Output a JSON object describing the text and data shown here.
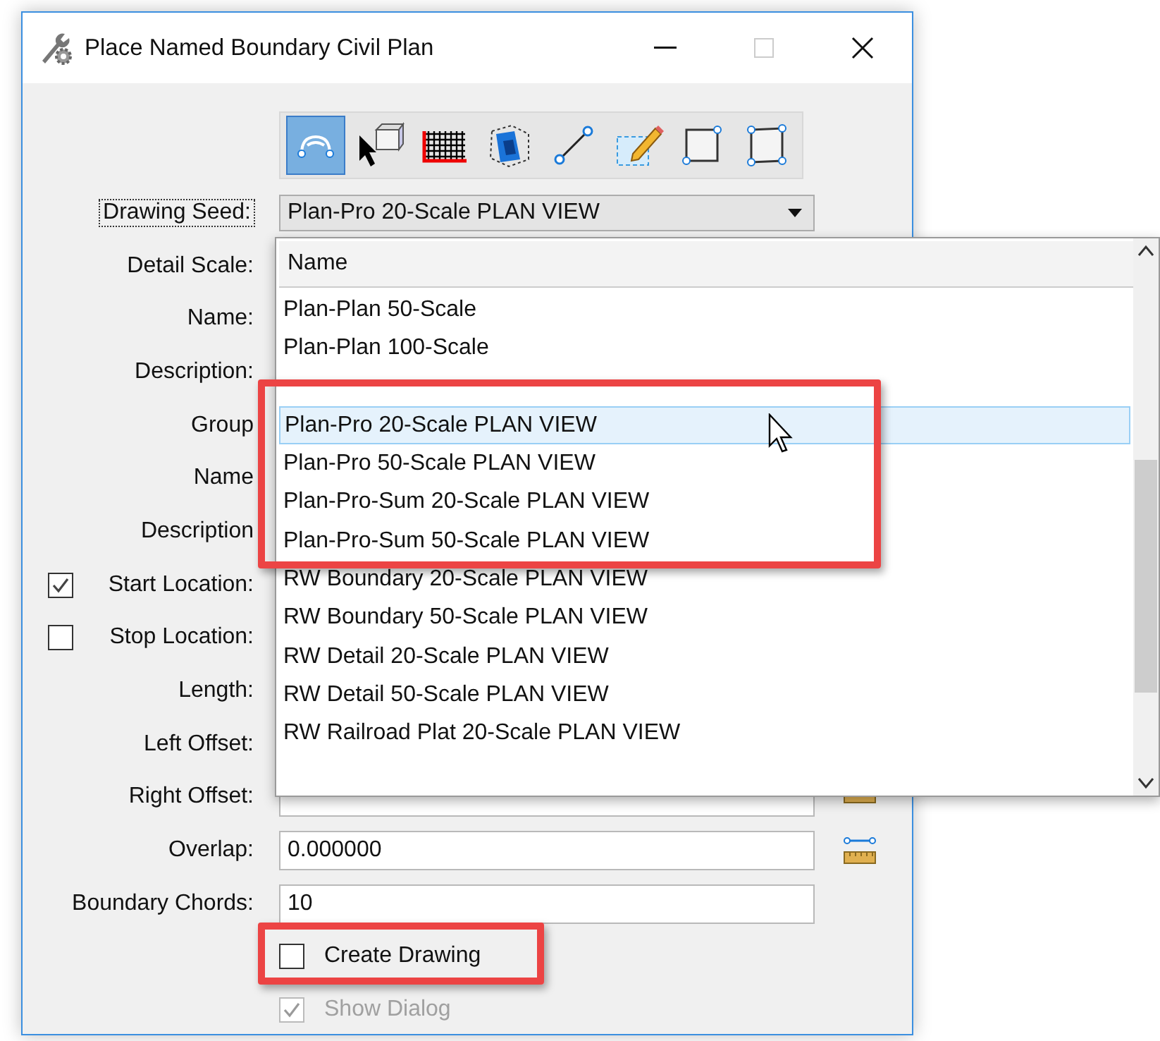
{
  "window": {
    "title": "Place Named Boundary Civil Plan"
  },
  "toolbar": [
    {
      "kind": "arc",
      "selected": true
    },
    {
      "kind": "select-cube",
      "selected": false
    },
    {
      "kind": "grid",
      "selected": false
    },
    {
      "kind": "view-cube",
      "selected": false
    },
    {
      "kind": "line",
      "selected": false
    },
    {
      "kind": "pencil",
      "selected": false
    },
    {
      "kind": "square",
      "selected": false
    },
    {
      "kind": "quad",
      "selected": false
    }
  ],
  "drawing_seed": {
    "label": "Drawing Seed:",
    "value": "Plan-Pro 20-Scale PLAN VIEW"
  },
  "fields": [
    {
      "kind": "text",
      "label": "Detail Scale:"
    },
    {
      "kind": "text",
      "label": "Name:"
    },
    {
      "kind": "text",
      "label": "Description:"
    },
    {
      "kind": "text",
      "label": "Group"
    },
    {
      "kind": "text",
      "label": "Name"
    },
    {
      "kind": "text",
      "label": "Description"
    },
    {
      "kind": "checkbox",
      "label": "Start Location:",
      "checked": true
    },
    {
      "kind": "checkbox",
      "label": "Stop Location:",
      "checked": false
    },
    {
      "kind": "text",
      "label": "Length:"
    },
    {
      "kind": "text",
      "label": "Left Offset:"
    },
    {
      "kind": "text",
      "label": "Right Offset:",
      "tools": [
        {
          "kind": "ruler"
        }
      ]
    },
    {
      "kind": "text",
      "label": "Overlap:",
      "value": "0.000000",
      "tools": [
        {
          "kind": "distance"
        }
      ]
    },
    {
      "kind": "text",
      "label": "Boundary Chords:",
      "value": "10"
    }
  ],
  "options": [
    {
      "label": "Create Drawing",
      "checked": false,
      "disabled": false
    },
    {
      "label": "Show Dialog",
      "checked": true,
      "disabled": true
    }
  ],
  "dropdown_list": {
    "column": "Name",
    "items": [
      {
        "label": "Plan-Plan 50-Scale",
        "selected": false
      },
      {
        "label": "Plan-Plan 100-Scale",
        "selected": false
      },
      {
        "selected": false
      },
      {
        "label": "Plan-Pro 20-Scale PLAN VIEW",
        "selected": true
      },
      {
        "label": "Plan-Pro 50-Scale PLAN VIEW",
        "selected": false
      },
      {
        "label": "Plan-Pro-Sum 20-Scale PLAN VIEW",
        "selected": false
      },
      {
        "label": "Plan-Pro-Sum 50-Scale PLAN VIEW",
        "selected": false
      },
      {
        "label": "RW Boundary 20-Scale PLAN VIEW",
        "selected": false
      },
      {
        "label": "RW Boundary 50-Scale PLAN VIEW",
        "selected": false
      },
      {
        "label": "RW Detail 20-Scale PLAN VIEW",
        "selected": false
      },
      {
        "label": "RW Detail 50-Scale PLAN VIEW",
        "selected": false
      },
      {
        "label": "RW Railroad Plat 20-Scale PLAN VIEW",
        "selected": false
      }
    ]
  }
}
